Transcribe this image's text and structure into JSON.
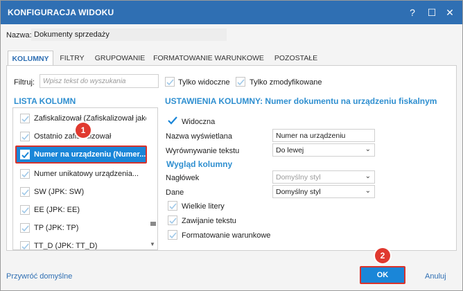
{
  "window": {
    "title": "KONFIGURACJA WIDOKU",
    "help_glyph": "?",
    "max_glyph": "☐",
    "close_glyph": "✕"
  },
  "name": {
    "label": "Nazwa:",
    "value": "Dokumenty sprzedaży"
  },
  "tabs": [
    {
      "label": "KOLUMNY",
      "active": true
    },
    {
      "label": "FILTRY",
      "active": false
    },
    {
      "label": "GRUPOWANIE",
      "active": false
    },
    {
      "label": "FORMATOWANIE WARUNKOWE",
      "active": false
    },
    {
      "label": "POZOSTAŁE",
      "active": false
    }
  ],
  "filter": {
    "label": "Filtruj:",
    "placeholder": "Wpisz tekst do wyszukania",
    "only_visible": "Tylko widoczne",
    "only_modified": "Tylko zmodyfikowane"
  },
  "list": {
    "title": "LISTA KOLUMN",
    "items": [
      {
        "label": "Zafiskalizował (Zafiskalizował jako...",
        "checked": true,
        "selected": false
      },
      {
        "label": "Ostatnio zafiskalizował",
        "checked": true,
        "selected": false
      },
      {
        "label": "Numer na urządzeniu (Numer...",
        "checked": true,
        "selected": true
      },
      {
        "label": "Numer unikatowy urządzenia...",
        "checked": true,
        "selected": false
      },
      {
        "label": "SW (JPK: SW)",
        "checked": true,
        "selected": false
      },
      {
        "label": "EE (JPK: EE)",
        "checked": true,
        "selected": false
      },
      {
        "label": "TP (JPK: TP)",
        "checked": true,
        "selected": false
      },
      {
        "label": "TT_D (JPK: TT_D)",
        "checked": true,
        "selected": false
      }
    ]
  },
  "settings": {
    "title": "USTAWIENIA KOLUMNY: Numer dokumentu na urządzeniu fiskalnym",
    "visible_label": "Widoczna",
    "display_name_label": "Nazwa wyświetlana",
    "display_name_value": "Numer na urządzeniu",
    "align_label": "Wyrównywanie tekstu",
    "align_value": "Do lewej",
    "appearance_title": "Wygląd kolumny",
    "header_label": "Nagłówek",
    "header_value": "Domyślny styl",
    "data_label": "Dane",
    "data_value": "Domyślny styl",
    "caps_label": "Wielkie litery",
    "wrap_label": "Zawijanie tekstu",
    "cond_label": "Formatowanie warunkowe"
  },
  "badges": {
    "one": "1",
    "two": "2"
  },
  "footer": {
    "restore": "Przywróć domyślne",
    "ok": "OK",
    "cancel": "Anuluj"
  },
  "colors": {
    "accent": "#2f6fb3",
    "selection": "#1a86d8",
    "highlight": "#d9322b"
  }
}
